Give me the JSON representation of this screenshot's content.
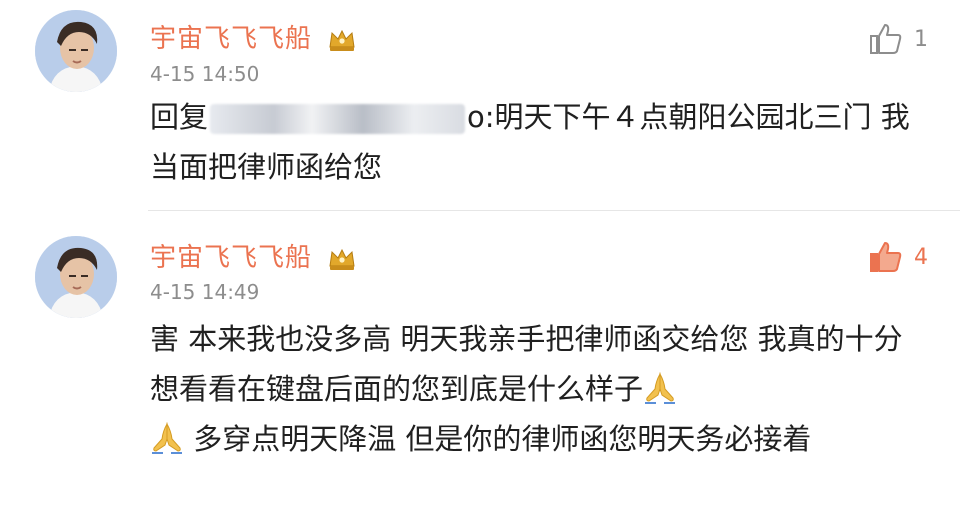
{
  "comments": [
    {
      "username": "宇宙飞飞飞船",
      "timestamp": "4-15 14:50",
      "likes": "1",
      "liked": false,
      "body_prefix": "回复",
      "body_suffix": "o:明天下午４点朝阳公园北三门 我当面把律师函给您"
    },
    {
      "username": "宇宙飞飞飞船",
      "timestamp": "4-15 14:49",
      "likes": "4",
      "liked": true,
      "body_part1": "害 本来我也没多高 明天我亲手把律师函交给您 我真的十分想看看在键盘后面的您到底是什么样子",
      "body_part2": " 多穿点明天降温 但是你的律师函您明天务必接着"
    }
  ],
  "colors": {
    "username": "#eb7350",
    "timestamp": "#8d8d8d",
    "text": "#202020",
    "like_active": "#eb7350",
    "like_inactive": "#8d8d8d"
  },
  "icons": {
    "avatar": "user-avatar",
    "crown": "vip-crown-icon",
    "like": "thumbs-up-icon",
    "emoji": "praying-hands-emoji"
  }
}
